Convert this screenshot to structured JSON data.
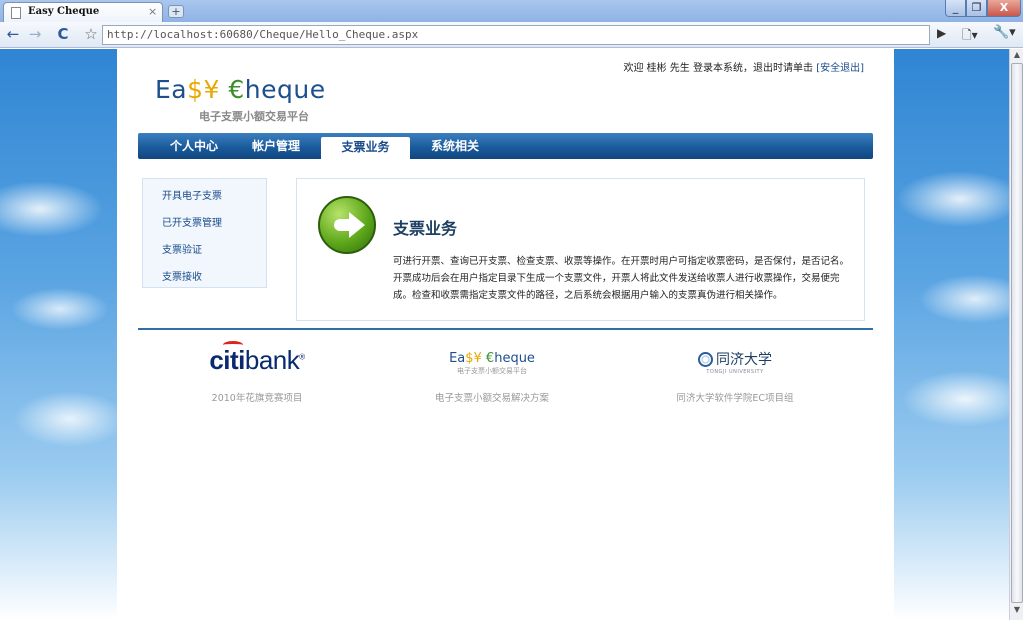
{
  "browser": {
    "tab_title": "Easy Cheque",
    "tab_close": "×",
    "new_tab": "+",
    "url": "http://localhost:60680/Cheque/Hello_Cheque.aspx",
    "win_min": "▭",
    "win_max": "❐",
    "win_close": "X"
  },
  "header": {
    "welcome_text": "欢迎 桂彬 先生 登录本系统，退出时请单击",
    "logout_link": "[安全退出]",
    "logo_part1": "Ea",
    "logo_symbols": "$¥",
    "logo_euro": " €",
    "logo_part2": "heque",
    "logo_subtitle": "电子支票小额交易平台"
  },
  "nav": {
    "items": [
      {
        "label": "个人中心"
      },
      {
        "label": "帐户管理"
      },
      {
        "label": "支票业务"
      },
      {
        "label": "系统相关"
      }
    ]
  },
  "sidebar": {
    "items": [
      {
        "label": "开具电子支票"
      },
      {
        "label": "已开支票管理"
      },
      {
        "label": "支票验证"
      },
      {
        "label": "支票接收"
      }
    ]
  },
  "content": {
    "title": "支票业务",
    "description": "可进行开票、查询已开支票、检查支票、收票等操作。在开票时用户可指定收票密码，是否保付，是否记名。开票成功后会在用户指定目录下生成一个支票文件，开票人将此文件发送给收票人进行收票操作，交易便完成。检查和收票需指定支票文件的路径，之后系统会根据用户输入的支票真伪进行相关操作。"
  },
  "footer": {
    "citi_prefix": "citi",
    "citi_suffix": "bank",
    "citi_mark": "®",
    "mini_logo_part1": "Ea",
    "mini_logo_symbols": "$¥",
    "mini_logo_euro": " €",
    "mini_logo_part2": "heque",
    "mini_logo_sub": "电子支票小额交易平台",
    "tongji_name": "同济大学",
    "tongji_sub": "TONGJI UNIVERSITY",
    "captions": [
      "2010年花旗竞赛项目",
      "电子支票小额交易解决方案",
      "同济大学软件学院EC项目组"
    ]
  },
  "colors": {
    "nav_blue": "#1a5b9c",
    "logo_blue": "#1d4f8f",
    "accent_green": "#5fa81c"
  }
}
